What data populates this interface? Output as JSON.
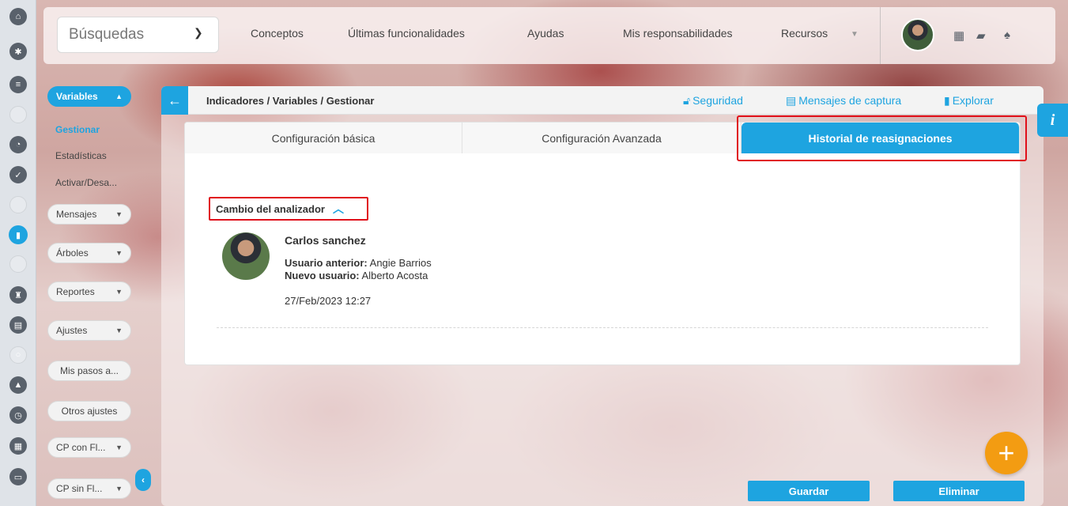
{
  "topbar": {
    "search_label": "Búsquedas",
    "nav": [
      "Conceptos",
      "Últimas funcionalidades",
      "Ayudas",
      "Mis responsabilidades",
      "Recursos"
    ]
  },
  "menu": {
    "active_group": "Variables",
    "submenu": [
      "Gestionar",
      "Estadísticas",
      "Activar/Desa..."
    ],
    "groups": [
      "Mensajes",
      "Árboles",
      "Reportes",
      "Ajustes",
      "Mis pasos a...",
      "Otros ajustes",
      "CP con Fl...",
      "CP sin Fl..."
    ]
  },
  "panel": {
    "breadcrumb": "Indicadores / Variables / Gestionar",
    "links": [
      "Seguridad",
      "Mensajes de captura",
      "Explorar"
    ],
    "tabs": [
      "Configuración básica",
      "Configuración Avanzada",
      "Historial de reasignaciones"
    ]
  },
  "history": {
    "section_title": "Cambio del analizador",
    "name": "Carlos sanchez",
    "prev_label": "Usuario anterior:",
    "prev_value": "Angie Barrios",
    "new_label": "Nuevo usuario:",
    "new_value": "Alberto Acosta",
    "date": "27/Feb/2023 12:27"
  },
  "buttons": {
    "save": "Guardar",
    "delete": "Eliminar"
  },
  "colors": {
    "accent": "#1ea4e0",
    "highlight": "#e0101a",
    "fab": "#f39c12"
  }
}
